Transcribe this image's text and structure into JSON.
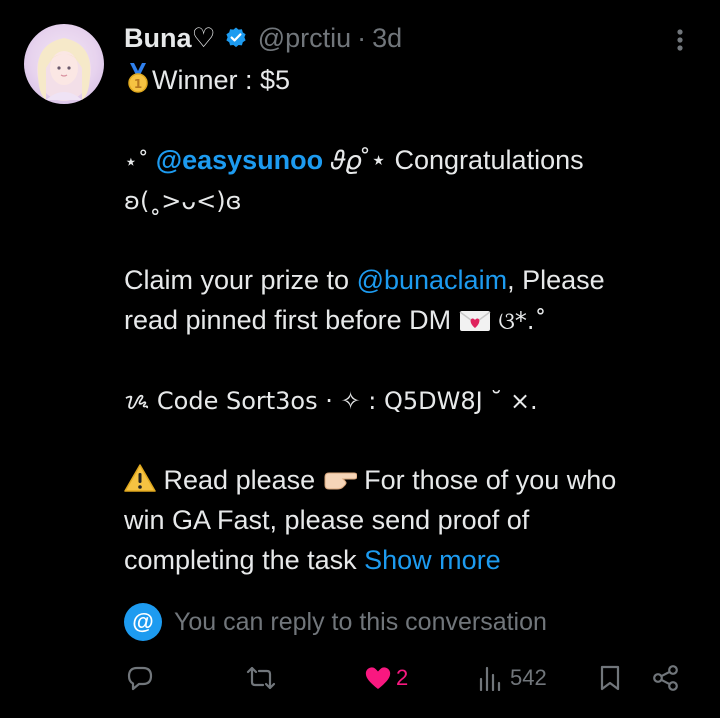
{
  "author": {
    "display_name": "Buna♡",
    "handle": "@prctiu",
    "separator": "·",
    "time": "3d"
  },
  "body": {
    "line1_icon": "medal-icon",
    "line1_text": "Winner : $5",
    "line2_prefix": "⋆˚ ",
    "line2_mention": "@easysunoo",
    "line2_suffix": " 𝜗𝜚˚⋆ Congratulations",
    "line3_text": "ʚ(˳>ᴗ<)ɞ",
    "line4_prefix": "Claim your prize to ",
    "line4_mention": "@bunaclaim",
    "line4_suffix": ", Please",
    "line5_text": "read pinned first before DM",
    "line5_icon": "love-letter-icon",
    "line5_suffix": " ଓ*.˚",
    "line6_text": "ᝰ Code Sort3os · ✧ : Q5DW8J ˘  ×.",
    "line7_prefix": "Read please",
    "line7_suffix": "For those of you who",
    "line8_text": "win GA Fast, please send proof of",
    "line9_text": "completing the task",
    "show_more": "Show more"
  },
  "reply_hint": {
    "icon_glyph": "@",
    "text": "You can reply to this conversation"
  },
  "actions": {
    "like_count": "2",
    "views_count": "542"
  },
  "colors": {
    "background": "#000000",
    "text": "#e7e9ea",
    "muted": "#71767b",
    "link": "#1d9bf0",
    "like": "#f91880"
  }
}
